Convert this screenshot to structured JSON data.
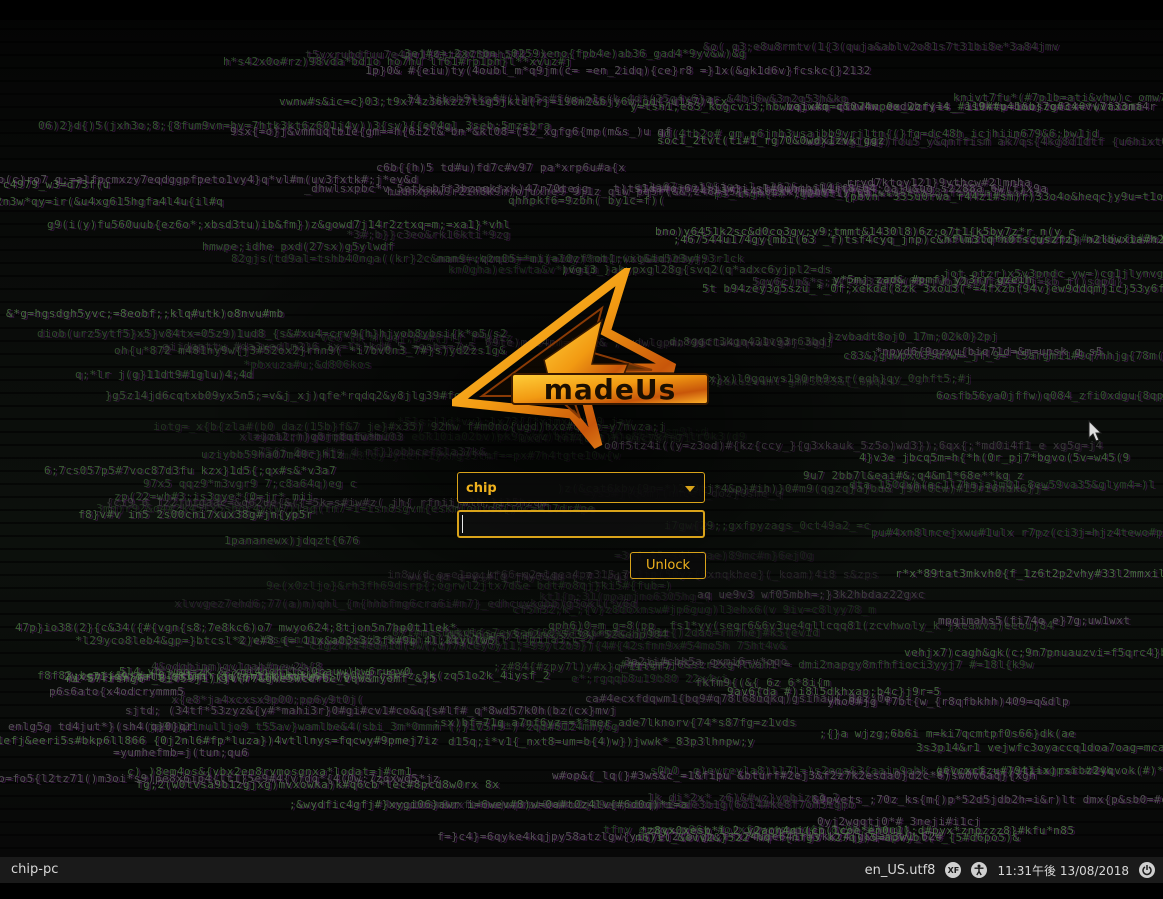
{
  "login": {
    "selected_user": "chip",
    "password_value": "",
    "unlock_label": "Unlock"
  },
  "panel": {
    "hostname": "chip-pc",
    "locale": "en_US.utf8",
    "keyboard_layout_icon": "xf-keyboard-icon",
    "accessibility_icon": "accessibility-icon",
    "clock": "11:31午後 13/08/2018",
    "power_icon": "power-icon"
  },
  "branding": {
    "logo_text": "Amadeus"
  },
  "colors": {
    "accent": "#d9a31a",
    "accent_text": "#f0b21d",
    "panel_bg": "#1a1a1a"
  }
}
